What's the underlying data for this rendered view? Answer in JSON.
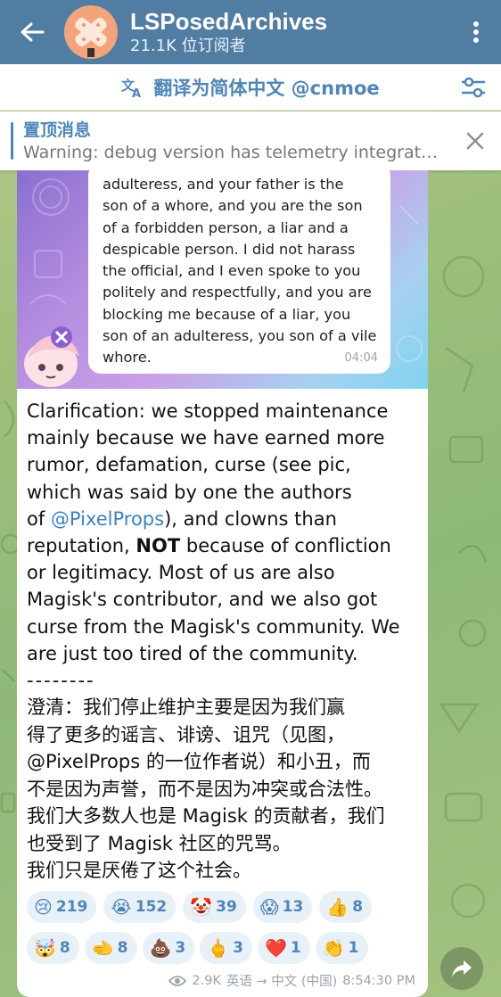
{
  "header": {
    "title": "LSPosedArchives",
    "subtitle": "21.1K 位订阅者",
    "back_icon": "arrow-left-icon",
    "menu_icon": "more-vertical-icon"
  },
  "translate_bar": {
    "label": "翻译为简体中文 @cnmoe",
    "icon": "translate-icon",
    "settings_icon": "sliders-icon"
  },
  "pinned": {
    "title": "置顶消息",
    "text": "Warning: debug version has telemetry integrat…",
    "close_icon": "close-icon"
  },
  "photo": {
    "lines": [
      "adulteress, and your father is the",
      "son of a whore, and you are the son",
      "of a forbidden person, a liar and a",
      "despicable person. I did not harass",
      "the official, and I even spoke to you",
      "politely and respectfully, and you are",
      "blocking me because of a liar, you",
      "son of an adulteress, you son of a vile",
      "whore."
    ],
    "time": "04:04"
  },
  "message": {
    "en_lines": [
      "Clarification: we stopped maintenance",
      "mainly because we have earned more",
      "rumor, defamation, curse (see pic,",
      "which was said by one the authors"
    ],
    "line5_pre": "of ",
    "line5_link": "@PixelProps",
    "line5_post": "), and clowns than",
    "line6_pre": "reputation, ",
    "line6_bold": "NOT",
    "line6_post": " because of confliction",
    "en_lines_b": [
      "or legitimacy. Most of us are also",
      "Magisk's contributor, and we also got",
      "curse from the Magisk's community. We",
      "are just too tired of the community."
    ],
    "separator": "--------",
    "zh_lines": [
      "澄清：我们停止维护主要是因为我们赢",
      "得了更多的谣言、诽谤、诅咒（见图，",
      "@PixelProps 的一位作者说）和小丑，而",
      "不是因为声誉，而不是因为冲突或合法性。",
      "我们大多数人也是 Magisk 的贡献者，我们",
      "也受到了 Magisk 社区的咒骂。",
      "我们只是厌倦了这个社会。"
    ]
  },
  "reactions": {
    "row1": [
      {
        "emoji": "😢",
        "count": "219"
      },
      {
        "emoji": "😭",
        "count": "152"
      },
      {
        "emoji": "🤡",
        "count": "39"
      },
      {
        "emoji": "😱",
        "count": "13"
      },
      {
        "emoji": "👍",
        "count": "8"
      }
    ],
    "row2": [
      {
        "emoji": "🤯",
        "count": "8"
      },
      {
        "emoji": "🫲",
        "count": "8"
      },
      {
        "emoji": "💩",
        "count": "3"
      },
      {
        "emoji": "🖕",
        "count": "3"
      },
      {
        "emoji": "❤️",
        "count": "1"
      },
      {
        "emoji": "👏",
        "count": "1"
      }
    ]
  },
  "meta": {
    "views": "2.9K",
    "translation": "英语 → 中文 (中国)",
    "time": "8:54:30 PM"
  },
  "colors": {
    "header_bg": "#517da2",
    "accent": "#4e86b8",
    "reaction_bg": "#e9f1f8"
  }
}
